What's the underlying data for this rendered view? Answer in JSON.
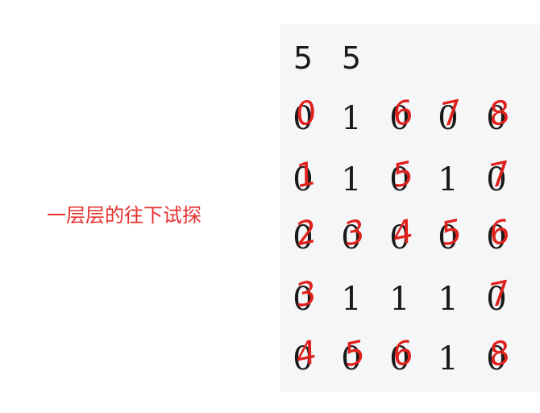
{
  "caption": "一层层的往下试探",
  "header": [
    "5",
    "5"
  ],
  "grid": [
    [
      "0",
      "1",
      "0",
      "0",
      "0"
    ],
    [
      "0",
      "1",
      "0",
      "1",
      "0"
    ],
    [
      "0",
      "0",
      "0",
      "0",
      "0"
    ],
    [
      "0",
      "1",
      "1",
      "1",
      "0"
    ],
    [
      "0",
      "0",
      "0",
      "1",
      "0"
    ]
  ],
  "annotations": [
    {
      "row": 0,
      "col": 0,
      "text": "0"
    },
    {
      "row": 0,
      "col": 2,
      "text": "6"
    },
    {
      "row": 0,
      "col": 3,
      "text": "7"
    },
    {
      "row": 0,
      "col": 4,
      "text": "8"
    },
    {
      "row": 1,
      "col": 0,
      "text": "1"
    },
    {
      "row": 1,
      "col": 2,
      "text": "5"
    },
    {
      "row": 1,
      "col": 4,
      "text": "7"
    },
    {
      "row": 2,
      "col": 0,
      "text": "2"
    },
    {
      "row": 2,
      "col": 1,
      "text": "3"
    },
    {
      "row": 2,
      "col": 2,
      "text": "4"
    },
    {
      "row": 2,
      "col": 3,
      "text": "5"
    },
    {
      "row": 2,
      "col": 4,
      "text": "6"
    },
    {
      "row": 3,
      "col": 0,
      "text": "3"
    },
    {
      "row": 3,
      "col": 4,
      "text": "7"
    },
    {
      "row": 4,
      "col": 0,
      "text": "4"
    },
    {
      "row": 4,
      "col": 1,
      "text": "5"
    },
    {
      "row": 4,
      "col": 2,
      "text": "6"
    },
    {
      "row": 4,
      "col": 4,
      "text": "8"
    }
  ],
  "colors": {
    "annotation": "#e0201c",
    "caption": "#e5302d",
    "panel": "#f5f6f8"
  }
}
